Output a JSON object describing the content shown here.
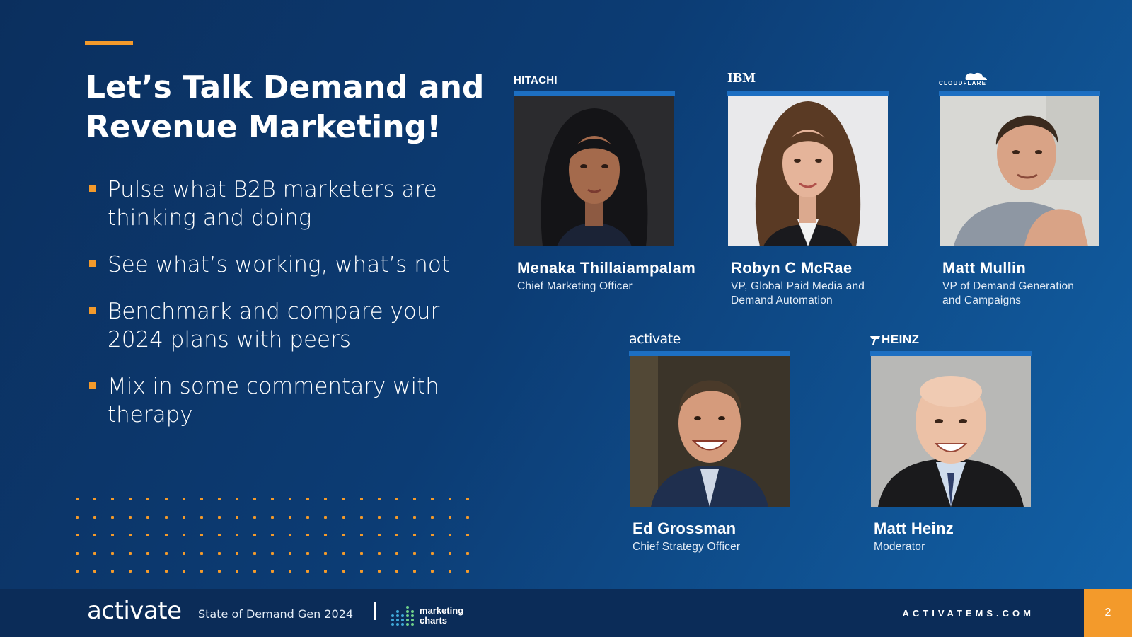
{
  "slide": {
    "title_line1": "Let’s Talk Demand and",
    "title_line2": "Revenue Marketing!",
    "bullets": [
      "Pulse what B2B marketers are thinking and doing",
      "See what’s working, what’s not",
      "Benchmark and compare your 2024 plans with peers",
      "Mix in some commentary with therapy"
    ]
  },
  "speakers": [
    {
      "company": "HITACHI",
      "name": "Menaka Thillaiampalam",
      "role_line1": "Chief Marketing Officer",
      "role_line2": ""
    },
    {
      "company": "IBM",
      "name": "Robyn C McRae",
      "role_line1": "VP, Global Paid Media and",
      "role_line2": "Demand Automation"
    },
    {
      "company": "CLOUDFLARE",
      "name": "Matt Mullin",
      "role_line1": "VP of Demand Generation",
      "role_line2": "and Campaigns"
    },
    {
      "company": "activate",
      "name": "Ed Grossman",
      "role_line1": "Chief Strategy Officer",
      "role_line2": ""
    },
    {
      "company": "HEINZ",
      "name": "Matt Heinz",
      "role_line1": "Moderator",
      "role_line2": ""
    }
  ],
  "footer": {
    "brand": "activate",
    "event": "State of Demand Gen 2024",
    "partner_line1": "marketing",
    "partner_line2": "charts",
    "url": "ACTIVATEMS.COM",
    "page_number": "2"
  },
  "colors": {
    "accent": "#f39a2b",
    "background_dark": "#0b2f5e",
    "background_light": "#1262a8",
    "photo_frame": "#1d6fc2",
    "footer": "#0b2c58"
  }
}
